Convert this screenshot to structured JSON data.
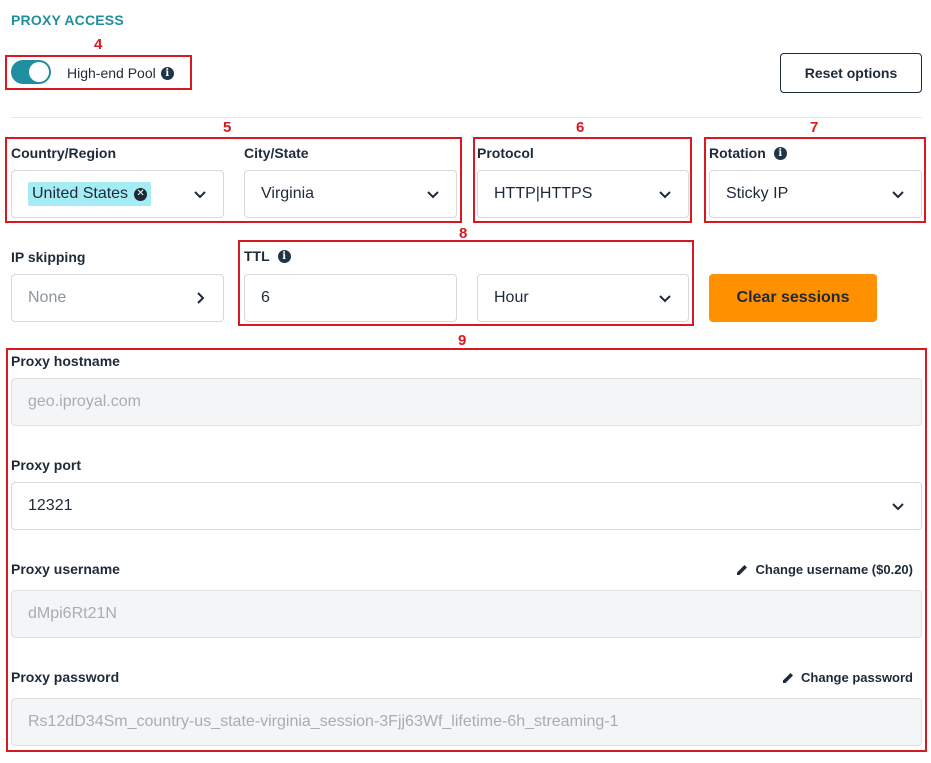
{
  "section_title": "PROXY ACCESS",
  "annotations": [
    "4",
    "5",
    "6",
    "7",
    "8",
    "9"
  ],
  "pool": {
    "label": "High-end Pool",
    "enabled": true
  },
  "reset_button": "Reset options",
  "location": {
    "country_label": "Country/Region",
    "country_value": "United States",
    "city_label": "City/State",
    "city_value": "Virginia"
  },
  "protocol": {
    "label": "Protocol",
    "value": "HTTP|HTTPS"
  },
  "rotation": {
    "label": "Rotation",
    "value": "Sticky IP"
  },
  "ip_skipping": {
    "label": "IP skipping",
    "value": "None"
  },
  "ttl": {
    "label": "TTL",
    "value": "6",
    "unit": "Hour"
  },
  "clear_sessions": "Clear sessions",
  "hostname": {
    "label": "Proxy hostname",
    "value": "geo.iproyal.com"
  },
  "port": {
    "label": "Proxy port",
    "value": "12321"
  },
  "username": {
    "label": "Proxy username",
    "value": "dMpi6Rt21N",
    "change_link": "Change username ($0.20)"
  },
  "password": {
    "label": "Proxy password",
    "value": "Rs12dD34Sm_country-us_state-virginia_session-3Fjj63Wf_lifetime-6h_streaming-1",
    "change_link": "Change password"
  },
  "colors": {
    "accent": "#1f8fa0",
    "orange": "#ff9100",
    "annotation": "#d71920",
    "chip": "#a6ecf5"
  }
}
